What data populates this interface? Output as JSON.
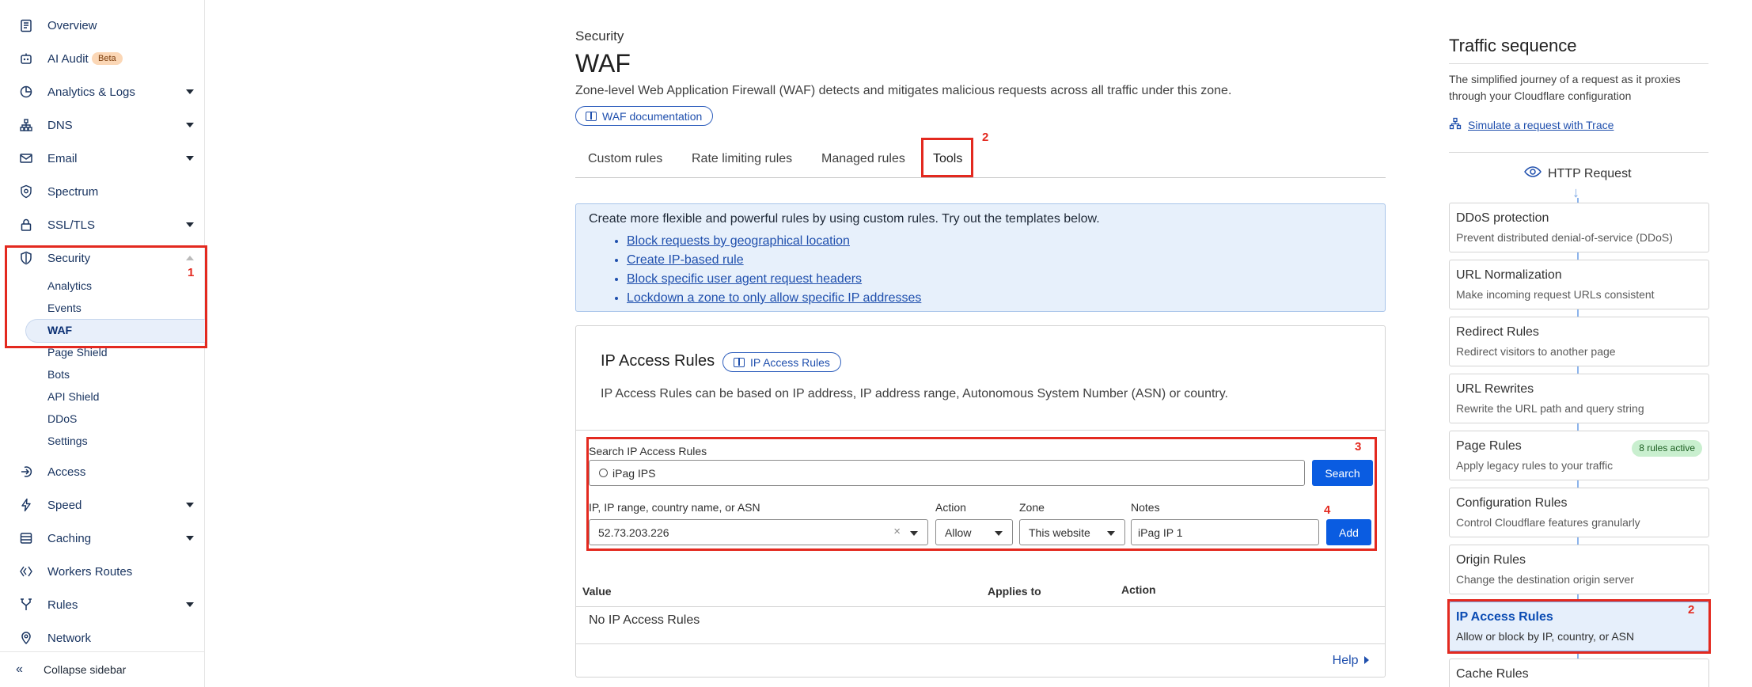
{
  "sidebar": {
    "items": [
      {
        "label": "Overview",
        "icon": "clipboard-icon"
      },
      {
        "label": "AI Audit",
        "badge": "Beta",
        "icon": "robot-icon"
      },
      {
        "label": "Analytics & Logs",
        "icon": "chart-pie-icon"
      },
      {
        "label": "DNS",
        "icon": "network-tree-icon"
      },
      {
        "label": "Email",
        "icon": "email-icon"
      },
      {
        "label": "Spectrum",
        "icon": "shield-gear-icon"
      },
      {
        "label": "SSL/TLS",
        "icon": "lock-icon"
      },
      {
        "label": "Security",
        "icon": "shield-icon"
      },
      {
        "label": "Access",
        "icon": "access-arrow-icon"
      },
      {
        "label": "Speed",
        "icon": "lightning-icon"
      },
      {
        "label": "Caching",
        "icon": "database-icon"
      },
      {
        "label": "Workers Routes",
        "icon": "workers-diamond-icon"
      },
      {
        "label": "Rules",
        "icon": "rules-fork-icon"
      },
      {
        "label": "Network",
        "icon": "location-pin-icon"
      }
    ],
    "security_sub": [
      "Analytics",
      "Events",
      "WAF",
      "Page Shield",
      "Bots",
      "API Shield",
      "DDoS",
      "Settings"
    ],
    "collapse_label": "Collapse sidebar"
  },
  "annotations": [
    "1",
    "2",
    "3",
    "4",
    "2"
  ],
  "main": {
    "breadcrumb": "Security",
    "title": "WAF",
    "description": "Zone-level Web Application Firewall (WAF) detects and mitigates malicious requests across all traffic under this zone.",
    "doc_link": "WAF documentation",
    "tabs": [
      "Custom rules",
      "Rate limiting rules",
      "Managed rules",
      "Tools"
    ],
    "active_tab": "Tools",
    "info": {
      "text": "Create more flexible and powerful rules by using custom rules. Try out the templates below.",
      "links": [
        "Block requests by geographical location",
        "Create IP-based rule",
        "Block specific user agent request headers",
        "Lockdown a zone to only allow specific IP addresses"
      ]
    },
    "ip_access": {
      "title": "IP Access Rules",
      "doc_pill": "IP Access Rules",
      "description": "IP Access Rules can be based on IP address, IP address range, Autonomous System Number (ASN) or country.",
      "search_label": "Search IP Access Rules",
      "search_value": "iPag IPS",
      "search_button": "Search",
      "ip_label": "IP, IP range, country name, or ASN",
      "ip_value": "52.73.203.226",
      "action_label": "Action",
      "action_value": "Allow",
      "zone_label": "Zone",
      "zone_value": "This website",
      "notes_label": "Notes",
      "notes_value": "iPag IP 1",
      "add_button": "Add",
      "table_headers": [
        "Value",
        "Applies to",
        "Action"
      ],
      "empty_text": "No IP Access Rules",
      "help": "Help"
    }
  },
  "right_panel": {
    "title": "Traffic sequence",
    "description": "The simplified journey of a request as it proxies through your Cloudflare configuration",
    "simulate_link": "Simulate a request with Trace",
    "http_request": "HTTP Request",
    "steps": [
      {
        "title": "DDoS protection",
        "subtitle": "Prevent distributed denial-of-service (DDoS)"
      },
      {
        "title": "URL Normalization",
        "subtitle": "Make incoming request URLs consistent"
      },
      {
        "title": "Redirect Rules",
        "subtitle": "Redirect visitors to another page"
      },
      {
        "title": "URL Rewrites",
        "subtitle": "Rewrite the URL path and query string"
      },
      {
        "title": "Page Rules",
        "subtitle": "Apply legacy rules to your traffic",
        "badge": "8 rules active"
      },
      {
        "title": "Configuration Rules",
        "subtitle": "Control Cloudflare features granularly"
      },
      {
        "title": "Origin Rules",
        "subtitle": "Change the destination origin server"
      },
      {
        "title": "IP Access Rules",
        "subtitle": "Allow or block by IP, country, or ASN"
      },
      {
        "title": "Cache Rules",
        "subtitle": ""
      }
    ]
  },
  "colors": {
    "accent": "#0a5ce1",
    "annotation_red": "#e3291f",
    "info_bg": "#e7f0fb"
  }
}
